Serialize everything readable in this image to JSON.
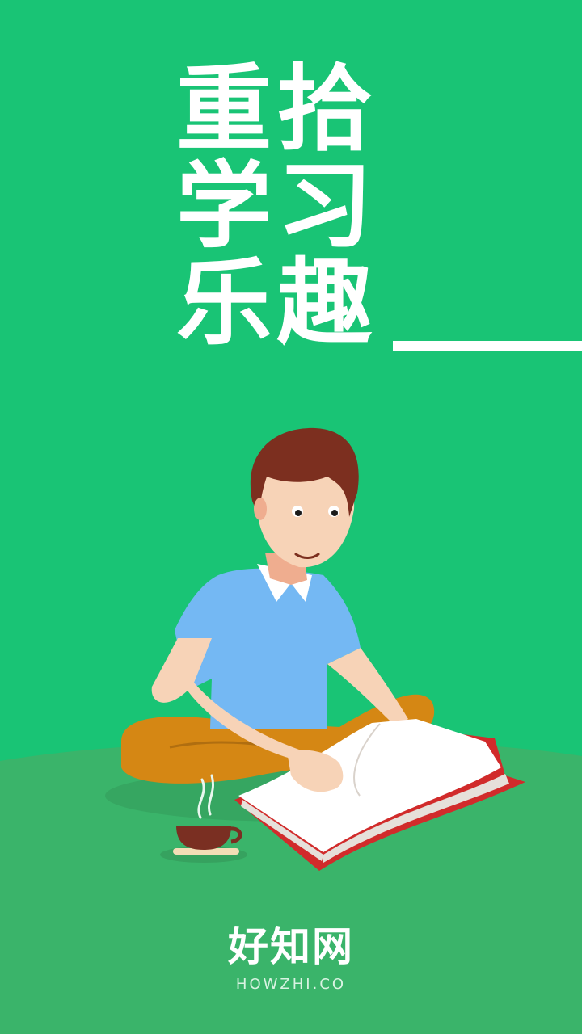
{
  "headline": {
    "lines": [
      "重拾",
      "学习",
      "乐趣"
    ]
  },
  "brand": {
    "name": "好知网",
    "url": "HOWZHI.CO"
  },
  "colors": {
    "background": "#19c475",
    "ground": "#3ab46a",
    "text": "#ffffff"
  },
  "illustration": {
    "subject": "person-reading-book",
    "items": [
      "reader",
      "open-book",
      "coffee-cup"
    ]
  }
}
